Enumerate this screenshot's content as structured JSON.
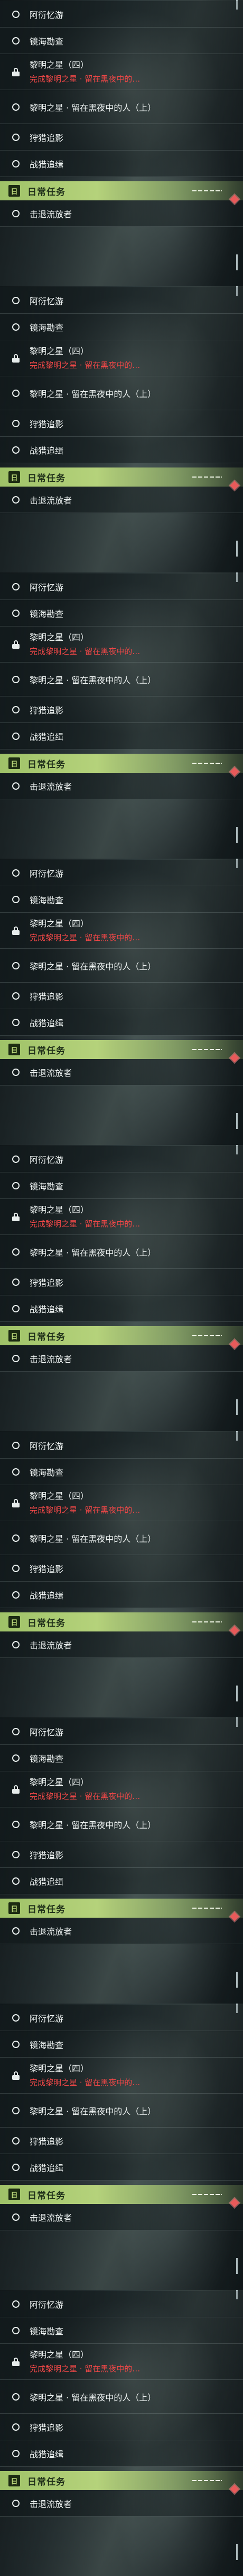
{
  "colors": {
    "accent_green": "#b5d27b",
    "alert_red": "#ee4747",
    "badge_red": "#e85a5a"
  },
  "icons": {
    "row": "circle-icon",
    "locked_row": "lock-icon",
    "section": "daily-mission-icon",
    "badge": "red-diamond-badge"
  },
  "panels": [
    {
      "rows": [
        {
          "label": "阿衍忆游"
        },
        {
          "label": "镜海勘查"
        },
        {
          "label": "黎明之星（四）",
          "sub": "完成黎明之星 · 留在黑夜中的…",
          "locked": true
        },
        {
          "label": "黎明之星 · 留在黑夜中的人（上）"
        },
        {
          "label": "狩猎追影"
        },
        {
          "label": "战猎追缉"
        }
      ],
      "section": {
        "icon_text": "日",
        "title": "日常任务"
      },
      "after_rows": [
        {
          "label": "击退流放者"
        }
      ]
    },
    {
      "rows": [
        {
          "label": "阿衍忆游"
        },
        {
          "label": "镜海勘查"
        },
        {
          "label": "黎明之星（四）",
          "sub": "完成黎明之星 · 留在黑夜中的…",
          "locked": true
        },
        {
          "label": "黎明之星 · 留在黑夜中的人（上）"
        },
        {
          "label": "狩猎追影"
        },
        {
          "label": "战猎追缉"
        }
      ],
      "section": {
        "icon_text": "日",
        "title": "日常任务"
      },
      "after_rows": [
        {
          "label": "击退流放者"
        }
      ]
    },
    {
      "rows": [
        {
          "label": "阿衍忆游"
        },
        {
          "label": "镜海勘查"
        },
        {
          "label": "黎明之星（四）",
          "sub": "完成黎明之星 · 留在黑夜中的…",
          "locked": true
        },
        {
          "label": "黎明之星 · 留在黑夜中的人（上）"
        },
        {
          "label": "狩猎追影"
        },
        {
          "label": "战猎追缉"
        }
      ],
      "section": {
        "icon_text": "日",
        "title": "日常任务"
      },
      "after_rows": [
        {
          "label": "击退流放者"
        }
      ]
    },
    {
      "rows": [
        {
          "label": "阿衍忆游"
        },
        {
          "label": "镜海勘查"
        },
        {
          "label": "黎明之星（四）",
          "sub": "完成黎明之星 · 留在黑夜中的…",
          "locked": true
        },
        {
          "label": "黎明之星 · 留在黑夜中的人（上）"
        },
        {
          "label": "狩猎追影"
        },
        {
          "label": "战猎追缉"
        }
      ],
      "section": {
        "icon_text": "日",
        "title": "日常任务"
      },
      "after_rows": [
        {
          "label": "击退流放者"
        }
      ]
    },
    {
      "rows": [
        {
          "label": "阿衍忆游"
        },
        {
          "label": "镜海勘查"
        },
        {
          "label": "黎明之星（四）",
          "sub": "完成黎明之星 · 留在黑夜中的…",
          "locked": true
        },
        {
          "label": "黎明之星 · 留在黑夜中的人（上）"
        },
        {
          "label": "狩猎追影"
        },
        {
          "label": "战猎追缉"
        }
      ],
      "section": {
        "icon_text": "日",
        "title": "日常任务"
      },
      "after_rows": [
        {
          "label": "击退流放者"
        }
      ]
    },
    {
      "rows": [
        {
          "label": "阿衍忆游"
        },
        {
          "label": "镜海勘查"
        },
        {
          "label": "黎明之星（四）",
          "sub": "完成黎明之星 · 留在黑夜中的…",
          "locked": true
        },
        {
          "label": "黎明之星 · 留在黑夜中的人（上）"
        },
        {
          "label": "狩猎追影"
        },
        {
          "label": "战猎追缉"
        }
      ],
      "section": {
        "icon_text": "日",
        "title": "日常任务"
      },
      "after_rows": [
        {
          "label": "击退流放者"
        }
      ]
    },
    {
      "rows": [
        {
          "label": "阿衍忆游"
        },
        {
          "label": "镜海勘查"
        },
        {
          "label": "黎明之星（四）",
          "sub": "完成黎明之星 · 留在黑夜中的…",
          "locked": true
        },
        {
          "label": "黎明之星 · 留在黑夜中的人（上）"
        },
        {
          "label": "狩猎追影"
        },
        {
          "label": "战猎追缉"
        }
      ],
      "section": {
        "icon_text": "日",
        "title": "日常任务"
      },
      "after_rows": [
        {
          "label": "击退流放者"
        }
      ]
    },
    {
      "rows": [
        {
          "label": "阿衍忆游"
        },
        {
          "label": "镜海勘查"
        },
        {
          "label": "黎明之星（四）",
          "sub": "完成黎明之星 · 留在黑夜中的…",
          "locked": true
        },
        {
          "label": "黎明之星 · 留在黑夜中的人（上）"
        },
        {
          "label": "狩猎追影"
        },
        {
          "label": "战猎追缉"
        }
      ],
      "section": {
        "icon_text": "日",
        "title": "日常任务"
      },
      "after_rows": [
        {
          "label": "击退流放者"
        }
      ]
    },
    {
      "rows": [
        {
          "label": "阿衍忆游"
        },
        {
          "label": "镜海勘查"
        },
        {
          "label": "黎明之星（四）",
          "sub": "完成黎明之星 · 留在黑夜中的…",
          "locked": true
        },
        {
          "label": "黎明之星 · 留在黑夜中的人（上）"
        },
        {
          "label": "狩猎追影"
        },
        {
          "label": "战猎追缉"
        }
      ],
      "section": {
        "icon_text": "日",
        "title": "日常任务"
      },
      "after_rows": [
        {
          "label": "击退流放者"
        }
      ]
    }
  ]
}
